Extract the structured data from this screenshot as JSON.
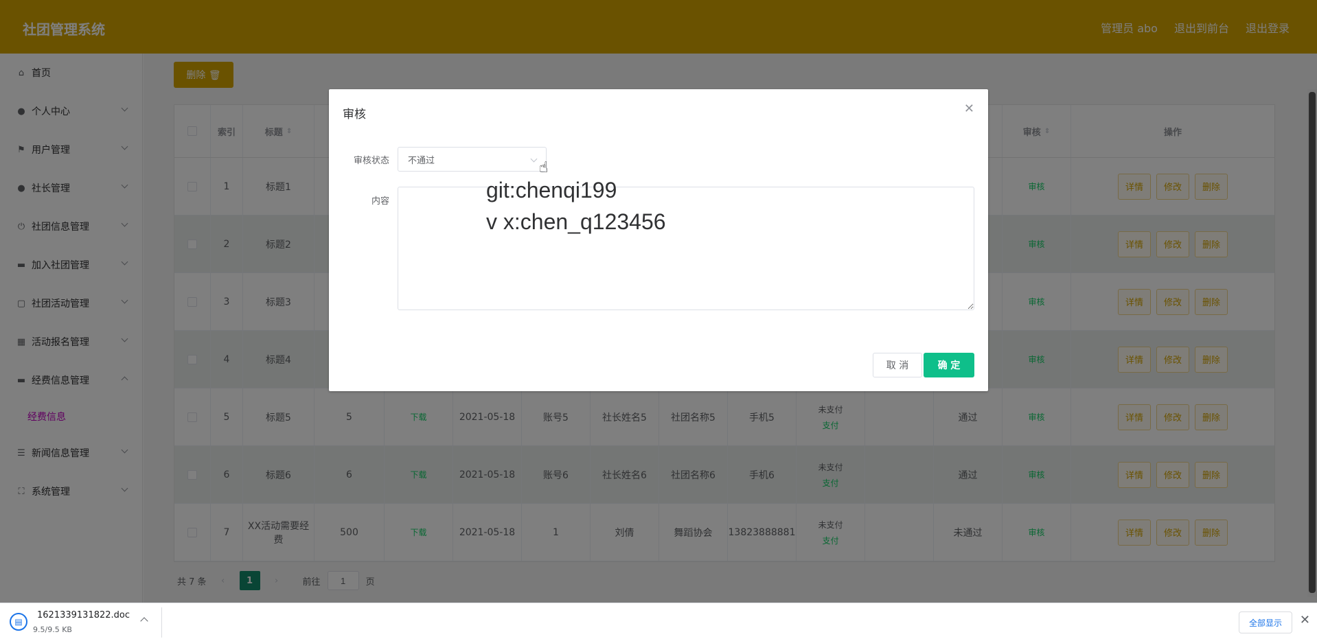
{
  "header": {
    "title": "社团管理系统",
    "links": [
      "管理员 abo",
      "退出到前台",
      "退出登录"
    ]
  },
  "sidebar": {
    "items": [
      {
        "label": "首页",
        "icon": "home-icon",
        "chevron": "none"
      },
      {
        "label": "个人中心",
        "icon": "user-icon",
        "chevron": "down"
      },
      {
        "label": "用户管理",
        "icon": "flag-icon",
        "chevron": "down"
      },
      {
        "label": "社长管理",
        "icon": "location-icon",
        "chevron": "down"
      },
      {
        "label": "社团信息管理",
        "icon": "power-icon",
        "chevron": "down"
      },
      {
        "label": "加入社团管理",
        "icon": "monitor-icon",
        "chevron": "down"
      },
      {
        "label": "社团活动管理",
        "icon": "chat-icon",
        "chevron": "down"
      },
      {
        "label": "活动报名管理",
        "icon": "grid-icon",
        "chevron": "down"
      },
      {
        "label": "经费信息管理",
        "icon": "monitor-icon",
        "chevron": "up"
      },
      {
        "label": "新闻信息管理",
        "icon": "list-icon",
        "chevron": "down"
      },
      {
        "label": "系统管理",
        "icon": "fullscreen-icon",
        "chevron": "down"
      }
    ],
    "submenu": {
      "label": "经费信息"
    }
  },
  "toolbar": {
    "delete_label": "删除 🗑"
  },
  "table": {
    "headers": [
      "索引",
      "标题",
      "审核",
      "操作"
    ],
    "rows": [
      {
        "index": "1",
        "title": "标题1",
        "c3": "",
        "download": "",
        "date": "",
        "account": "",
        "leader": "",
        "club": "",
        "phone": "",
        "pay_status": "",
        "pay_link": "",
        "c12": "",
        "audit": "",
        "audit_link": "审核"
      },
      {
        "index": "2",
        "title": "标题2",
        "c3": "",
        "download": "",
        "date": "",
        "account": "",
        "leader": "",
        "club": "",
        "phone": "",
        "pay_status": "",
        "pay_link": "",
        "c12": "",
        "audit": "",
        "audit_link": "审核"
      },
      {
        "index": "3",
        "title": "标题3",
        "c3": "",
        "download": "",
        "date": "",
        "account": "",
        "leader": "",
        "club": "",
        "phone": "",
        "pay_status": "",
        "pay_link": "",
        "c12": "",
        "audit": "",
        "audit_link": "审核"
      },
      {
        "index": "4",
        "title": "标题4",
        "c3": "",
        "download": "",
        "date": "",
        "account": "",
        "leader": "",
        "club": "",
        "phone": "",
        "pay_status": "",
        "pay_link": "",
        "c12": "",
        "audit": "",
        "audit_link": "审核"
      },
      {
        "index": "5",
        "title": "标题5",
        "c3": "5",
        "download": "下载",
        "date": "2021-05-18",
        "account": "账号5",
        "leader": "社长姓名5",
        "club": "社团名称5",
        "phone": "手机5",
        "pay_status": "未支付",
        "pay_link": "支付",
        "c12": "",
        "audit": "通过",
        "audit_link": "审核"
      },
      {
        "index": "6",
        "title": "标题6",
        "c3": "6",
        "download": "下载",
        "date": "2021-05-18",
        "account": "账号6",
        "leader": "社长姓名6",
        "club": "社团名称6",
        "phone": "手机6",
        "pay_status": "未支付",
        "pay_link": "支付",
        "c12": "",
        "audit": "通过",
        "audit_link": "审核"
      },
      {
        "index": "7",
        "title": "XX活动需要经费",
        "c3": "500",
        "download": "下载",
        "date": "2021-05-18",
        "account": "1",
        "leader": "刘倩",
        "club": "舞蹈协会",
        "phone": "13823888881",
        "pay_status": "未支付",
        "pay_link": "支付",
        "c12": "",
        "audit": "未通过",
        "audit_link": "审核"
      }
    ],
    "op_labels": {
      "detail": "详情",
      "edit": "修改",
      "delete": "删除"
    }
  },
  "pagination": {
    "total": "共 7 条",
    "current": "1",
    "goto_prefix": "前往",
    "goto_value": "1",
    "goto_suffix": "页"
  },
  "dialog": {
    "title": "审核",
    "status_label": "审核状态",
    "status_value": "不通过",
    "content_label": "内容",
    "watermark_line1": "git:chenqi199",
    "watermark_line2": "v x:chen_q123456",
    "cancel_label": "取 消",
    "ok_label": "确 定"
  },
  "download_bar": {
    "file_name": "1621339131822.doc",
    "file_size": "9.5/9.5 KB",
    "show_all": "全部显示"
  },
  "colors": {
    "brand": "#d4a400",
    "primary_green": "#0fbf8a"
  }
}
